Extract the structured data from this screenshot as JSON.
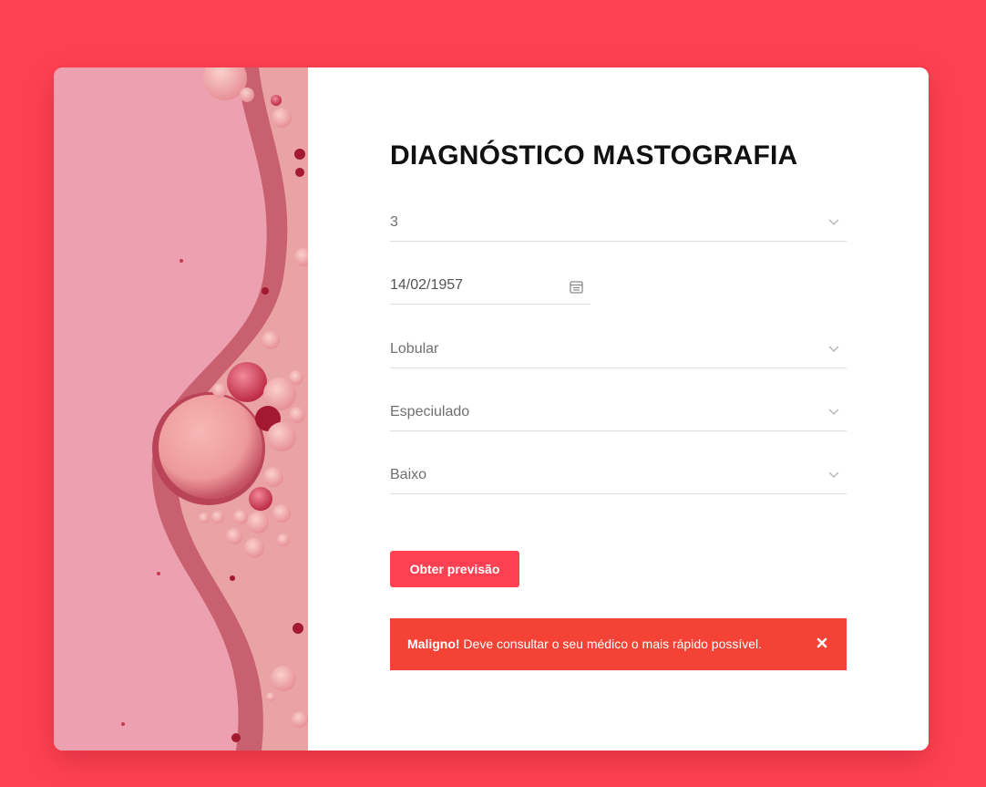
{
  "page": {
    "title": "DIAGNÓSTICO MASTOGRAFIA"
  },
  "form": {
    "fields": [
      {
        "value": "3"
      },
      {
        "value": "14/02/1957"
      },
      {
        "value": "Lobular"
      },
      {
        "value": "Especiulado"
      },
      {
        "value": "Baixo"
      }
    ],
    "submit_label": "Obter previsão"
  },
  "alert": {
    "strong": "Maligno!",
    "message": " Deve consultar o seu médico o mais rápido possível."
  },
  "icons": {
    "dropdown": "chevron-down-icon",
    "date": "calendar-icon",
    "close": "close-icon"
  },
  "colors": {
    "background": "#fe4152",
    "button": "#fe4152",
    "alert": "#f44336"
  }
}
